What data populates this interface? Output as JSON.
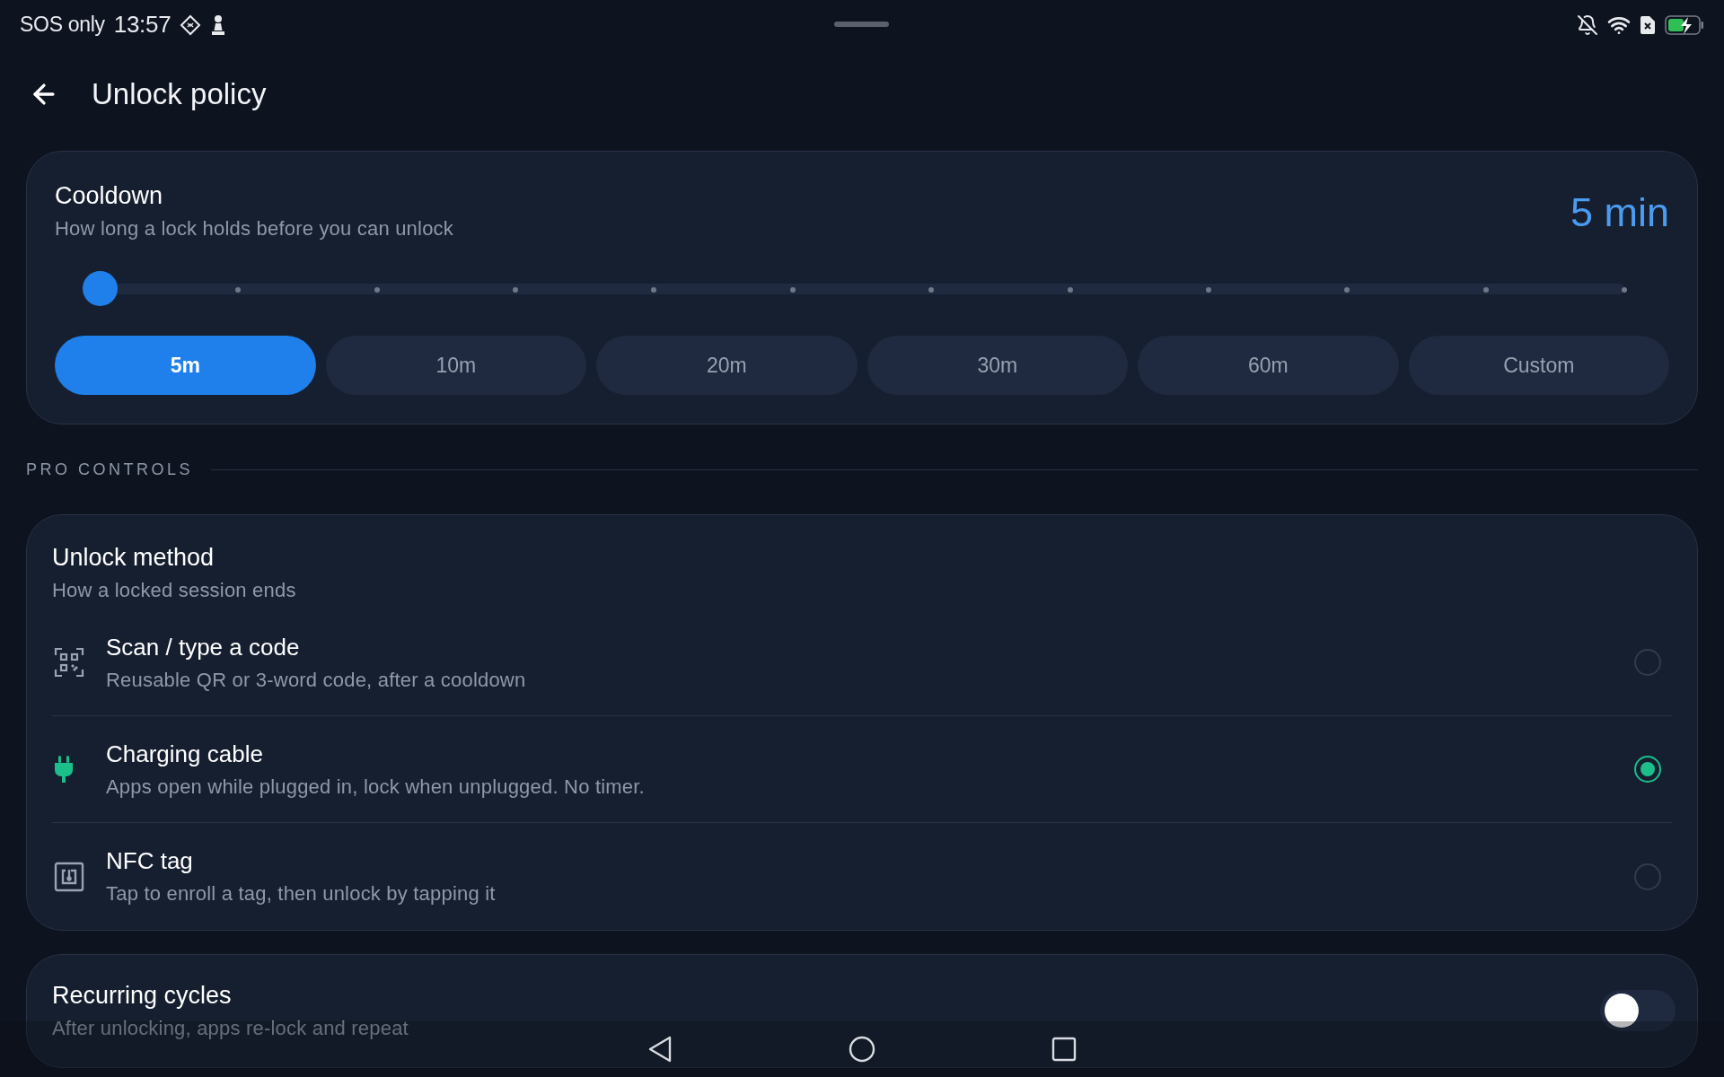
{
  "status_bar": {
    "carrier": "SOS only",
    "time": "13:57"
  },
  "header": {
    "title": "Unlock policy"
  },
  "cooldown": {
    "title": "Cooldown",
    "subtitle": "How long a lock holds before you can unlock",
    "value": "5 min",
    "slider": {
      "level": 0
    },
    "presets": [
      {
        "label": "5m",
        "selected": true
      },
      {
        "label": "10m",
        "selected": false
      },
      {
        "label": "20m",
        "selected": false
      },
      {
        "label": "30m",
        "selected": false
      },
      {
        "label": "60m",
        "selected": false
      },
      {
        "label": "Custom",
        "selected": false
      }
    ]
  },
  "section_label": "PRO CONTROLS",
  "unlock_method": {
    "title": "Unlock method",
    "subtitle": "How a locked session ends",
    "options": [
      {
        "kind": "code",
        "title": "Scan / type a code",
        "description": "Reusable QR or 3-word code, after a cooldown",
        "selected": false
      },
      {
        "kind": "cable",
        "title": "Charging cable",
        "description": "Apps open while plugged in, lock when unplugged. No timer.",
        "selected": true
      },
      {
        "kind": "nfc",
        "title": "NFC tag",
        "description": "Tap to enroll a tag, then unlock by tapping it",
        "selected": false
      }
    ]
  },
  "recurring": {
    "title": "Recurring cycles",
    "subtitle": "After unlocking, apps re-lock and repeat",
    "on": false
  }
}
